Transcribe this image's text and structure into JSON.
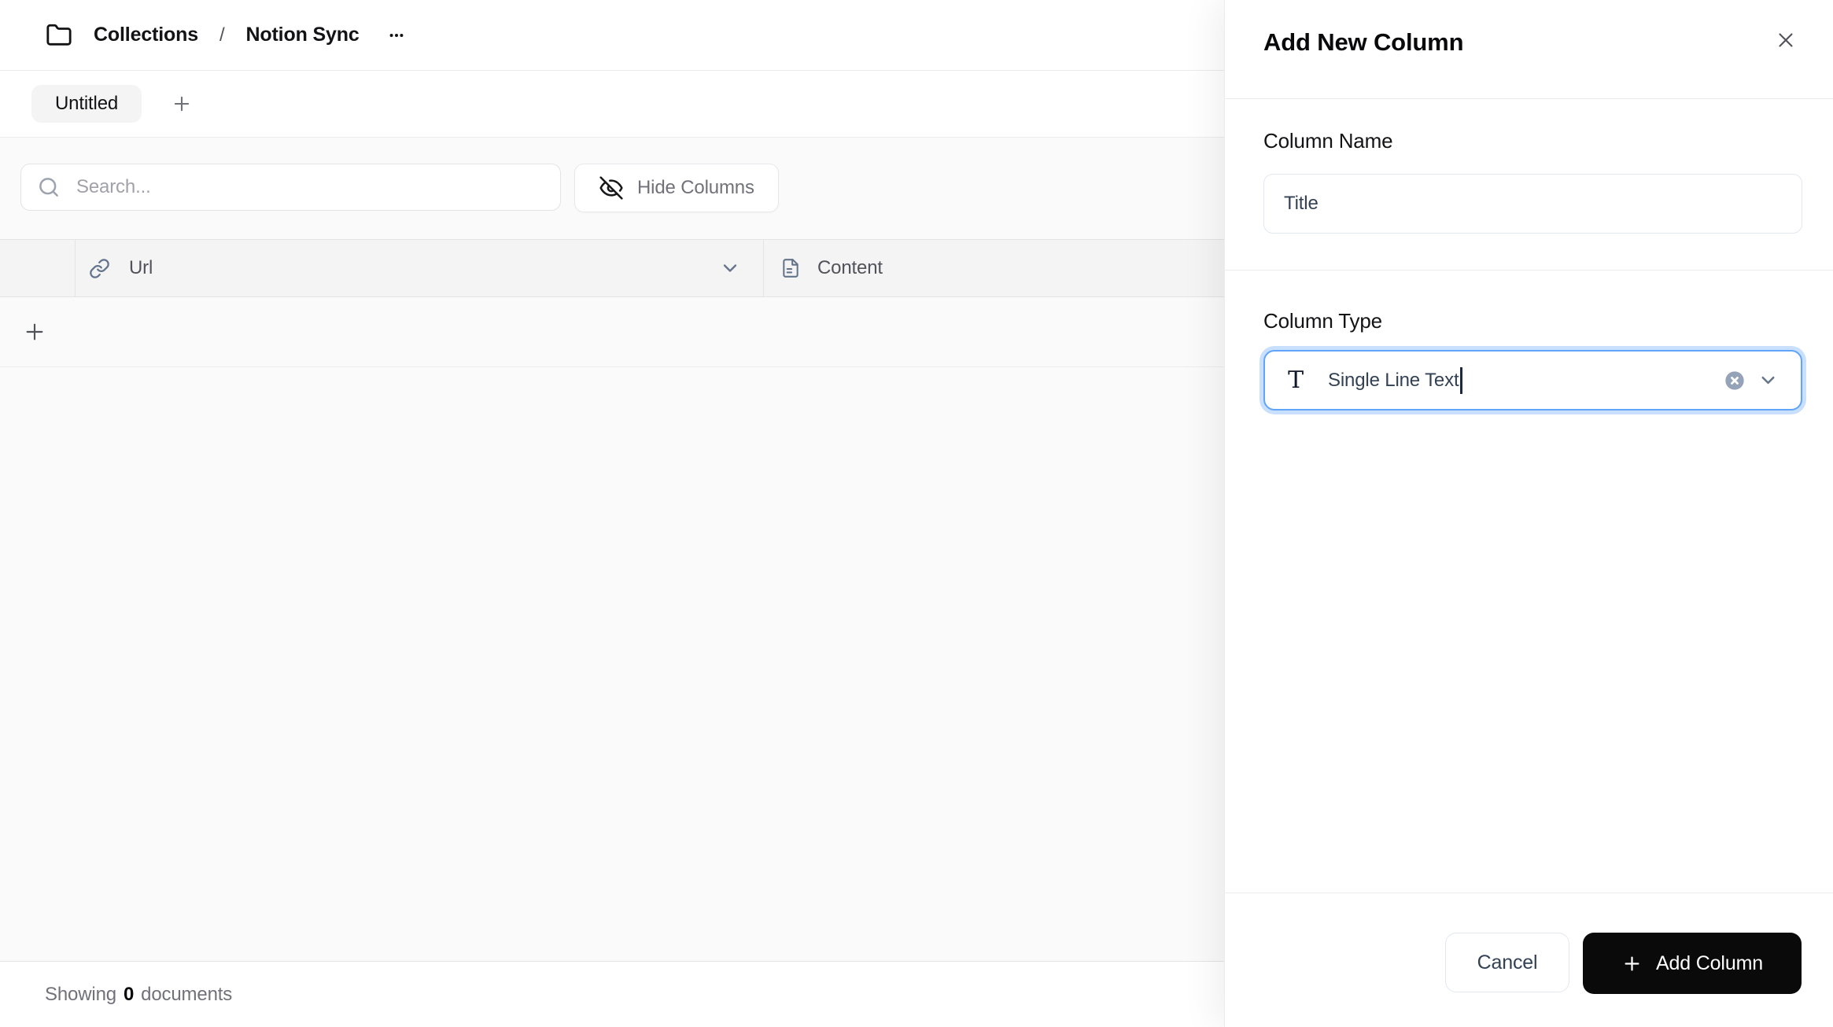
{
  "breadcrumb": {
    "folder_icon": "folder-icon",
    "items": [
      "Collections",
      "Notion Sync"
    ],
    "separator": "/",
    "more_icon": "ellipsis-icon"
  },
  "tabs": {
    "items": [
      {
        "label": "Untitled",
        "active": true
      }
    ],
    "add_icon": "plus-icon"
  },
  "toolbar": {
    "search": {
      "placeholder": "Search...",
      "icon": "search-icon"
    },
    "hide_columns": {
      "label": "Hide Columns",
      "icon": "eye-off-icon"
    }
  },
  "table": {
    "columns": [
      {
        "label": "Url",
        "icon": "link-icon",
        "menu_icon": "chevron-down-icon"
      },
      {
        "label": "Content",
        "icon": "file-text-icon"
      }
    ],
    "rows": [],
    "add_row_icon": "plus-icon"
  },
  "status": {
    "prefix": "Showing",
    "count": "0",
    "suffix": "documents"
  },
  "panel": {
    "title": "Add New Column",
    "close_icon": "close-icon",
    "fields": [
      {
        "label": "Column Name",
        "value": "Title",
        "type": "text"
      },
      {
        "label": "Column Type",
        "value": "Single Line Text",
        "type": "select",
        "icon": "text-type-icon",
        "clear_icon": "clear-circle-icon",
        "chevron_icon": "chevron-down-icon"
      }
    ],
    "footer": {
      "cancel_label": "Cancel",
      "submit_label": "Add Column",
      "submit_icon": "plus-icon"
    }
  },
  "colors": {
    "focus_border": "#60a5fa",
    "focus_ring": "rgba(96,165,250,0.35)",
    "submit_bg": "#0a0a0a",
    "table_header_bg": "#f4f4f5",
    "surface_bg": "#fafafa",
    "border": "#e4e4e7",
    "muted_text": "#71717a",
    "placeholder_text": "#a1a1aa",
    "value_text": "#334155"
  }
}
